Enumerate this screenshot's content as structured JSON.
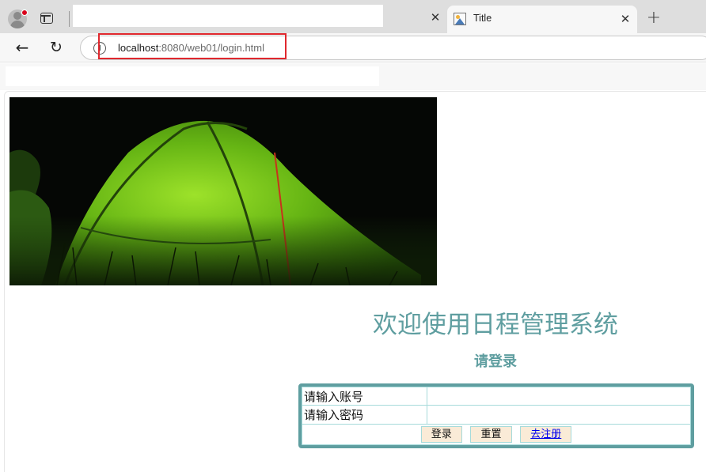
{
  "browser": {
    "tabs": [
      {
        "title": ""
      },
      {
        "title": "Title",
        "active": true
      }
    ],
    "url_host": "localhost",
    "url_path": ":8080/web01/login.html",
    "highlight_color": "#e0282e"
  },
  "page": {
    "welcome_title": "欢迎使用日程管理系统",
    "subtitle": "请登录",
    "form": {
      "username_label": "请输入账号",
      "password_label": "请输入密码",
      "username_value": "",
      "password_value": "",
      "login_button": "登录",
      "reset_button": "重置",
      "register_link": "去注册"
    },
    "colors": {
      "accent": "#5f9ea0",
      "cell_border": "#a6dada",
      "button_bg": "#faebd7"
    }
  }
}
